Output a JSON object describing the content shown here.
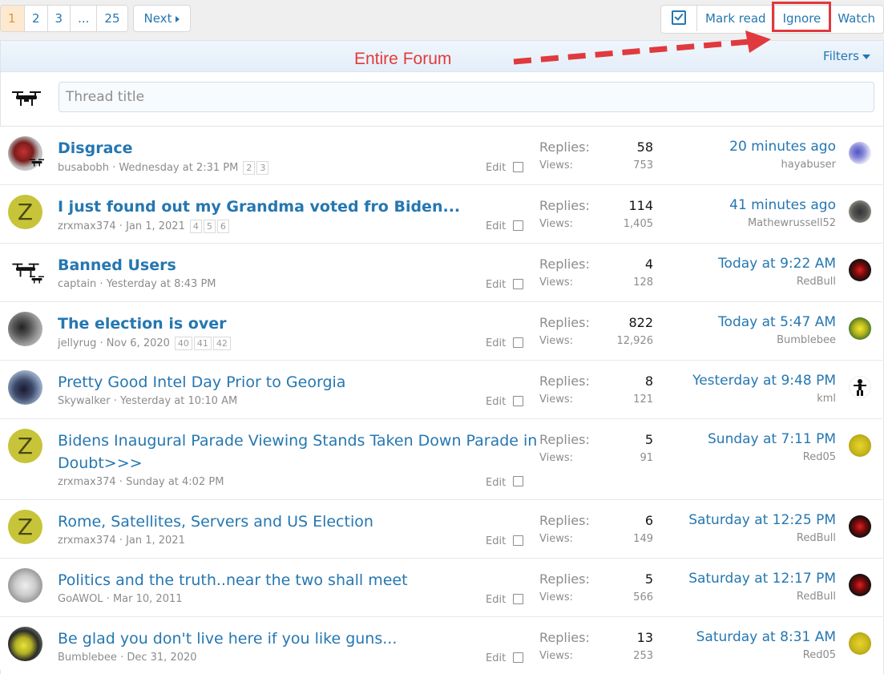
{
  "pagination": {
    "pages": [
      "1",
      "2",
      "3",
      "...",
      "25"
    ],
    "active": "1",
    "next_label": "Next"
  },
  "actions": {
    "mark_read_icon": "checkbox-icon",
    "mark_read": "Mark read",
    "ignore": "Ignore",
    "watch": "Watch"
  },
  "annotation": {
    "text": "Entire Forum",
    "color": "#e23b3b"
  },
  "filters": {
    "label": "Filters"
  },
  "quick_thread": {
    "placeholder": "Thread title"
  },
  "threads": [
    {
      "title": "Disgrace",
      "bold": true,
      "author": "busabobh",
      "date": "Wednesday at 2:31 PM",
      "pages": [
        "2",
        "3"
      ],
      "edit": "Edit",
      "replies_label": "Replies:",
      "replies": "58",
      "views_label": "Views:",
      "views": "753",
      "last_time": "20 minutes ago",
      "last_user": "hayabuser"
    },
    {
      "title": "I just found out my Grandma voted fro Biden...",
      "bold": true,
      "author": "zrxmax374",
      "date": "Jan 1, 2021",
      "pages": [
        "4",
        "5",
        "6"
      ],
      "edit": "Edit",
      "replies_label": "Replies:",
      "replies": "114",
      "views_label": "Views:",
      "views": "1,405",
      "last_time": "41 minutes ago",
      "last_user": "Mathewrussell52"
    },
    {
      "title": "Banned Users",
      "bold": true,
      "author": "captain",
      "date": "Yesterday at 8:43 PM",
      "pages": [],
      "edit": "Edit",
      "replies_label": "Replies:",
      "replies": "4",
      "views_label": "Views:",
      "views": "128",
      "last_time": "Today at 9:22 AM",
      "last_user": "RedBull"
    },
    {
      "title": "The election is over",
      "bold": true,
      "author": "jellyrug",
      "date": "Nov 6, 2020",
      "pages": [
        "40",
        "41",
        "42"
      ],
      "edit": "Edit",
      "replies_label": "Replies:",
      "replies": "822",
      "views_label": "Views:",
      "views": "12,926",
      "last_time": "Today at 5:47 AM",
      "last_user": "Bumblebee"
    },
    {
      "title": "Pretty Good Intel Day Prior to Georgia",
      "bold": false,
      "author": "Skywalker",
      "date": "Yesterday at 10:10 AM",
      "pages": [],
      "edit": "Edit",
      "replies_label": "Replies:",
      "replies": "8",
      "views_label": "Views:",
      "views": "121",
      "last_time": "Yesterday at 9:48 PM",
      "last_user": "kml"
    },
    {
      "title_line1": "Bidens Inaugural Parade Viewing Stands Taken Down Parade in",
      "title_line2": "Doubt>>>",
      "bold": false,
      "author": "zrxmax374",
      "date": "Sunday at 4:02 PM",
      "pages": [],
      "edit": "Edit",
      "replies_label": "Replies:",
      "replies": "5",
      "views_label": "Views:",
      "views": "91",
      "last_time": "Sunday at 7:11 PM",
      "last_user": "Red05"
    },
    {
      "title": "Rome, Satellites, Servers and US Election",
      "bold": false,
      "author": "zrxmax374",
      "date": "Jan 1, 2021",
      "pages": [],
      "edit": "Edit",
      "replies_label": "Replies:",
      "replies": "6",
      "views_label": "Views:",
      "views": "149",
      "last_time": "Saturday at 12:25 PM",
      "last_user": "RedBull"
    },
    {
      "title": "Politics and the truth..near the two shall meet",
      "bold": false,
      "author": "GoAWOL",
      "date": "Mar 10, 2011",
      "pages": [],
      "edit": "Edit",
      "replies_label": "Replies:",
      "replies": "5",
      "views_label": "Views:",
      "views": "566",
      "last_time": "Saturday at 12:17 PM",
      "last_user": "RedBull"
    },
    {
      "title": "Be glad you don't live here if you like guns...",
      "bold": false,
      "author": "Bumblebee",
      "date": "Dec 31, 2020",
      "pages": [],
      "edit": "Edit",
      "replies_label": "Replies:",
      "replies": "13",
      "views_label": "Views:",
      "views": "253",
      "last_time": "Saturday at 8:31 AM",
      "last_user": "Red05"
    }
  ],
  "avatar_letters": {
    "zrxmax374": "Z"
  }
}
